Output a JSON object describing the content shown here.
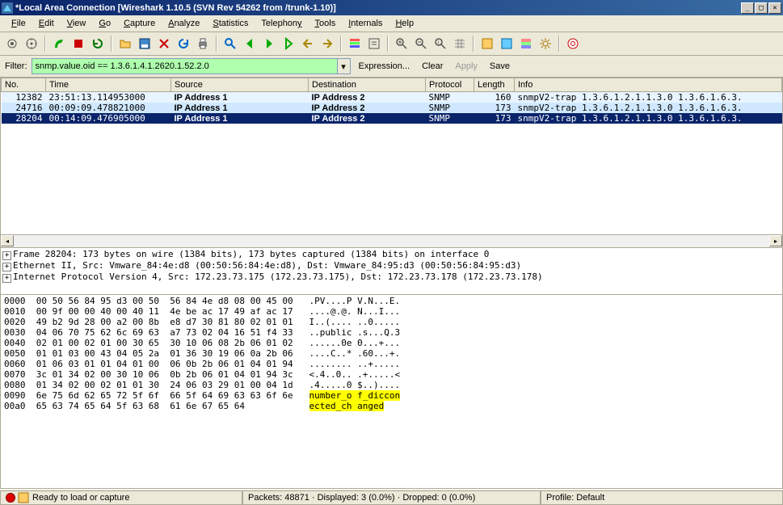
{
  "title": "*Local Area Connection   [Wireshark 1.10.5  (SVN Rev 54262 from /trunk-1.10)]",
  "menu": [
    "File",
    "Edit",
    "View",
    "Go",
    "Capture",
    "Analyze",
    "Statistics",
    "Telephony",
    "Tools",
    "Internals",
    "Help"
  ],
  "filter": {
    "label": "Filter:",
    "value": "snmp.value.oid == 1.3.6.1.4.1.2620.1.52.2.0",
    "expression": "Expression...",
    "clear": "Clear",
    "apply": "Apply",
    "save": "Save"
  },
  "columns": [
    "No.",
    "Time",
    "Source",
    "Destination",
    "Protocol",
    "Length",
    "Info"
  ],
  "rows": [
    {
      "no": "12382",
      "time": "23:51:13.114953000",
      "src": "IP Address 1",
      "dst": "IP Address 2",
      "proto": "SNMP",
      "len": "160",
      "info": "snmpV2-trap 1.3.6.1.2.1.1.3.0 1.3.6.1.6.3."
    },
    {
      "no": "24716",
      "time": "00:09:09.478821000",
      "src": "IP Address 1",
      "dst": "IP Address 2",
      "proto": "SNMP",
      "len": "173",
      "info": "snmpV2-trap 1.3.6.1.2.1.1.3.0 1.3.6.1.6.3."
    },
    {
      "no": "28204",
      "time": "00:14:09.476905000",
      "src": "IP Address 1",
      "dst": "IP Address 2",
      "proto": "SNMP",
      "len": "173",
      "info": "snmpV2-trap 1.3.6.1.2.1.1.3.0 1.3.6.1.6.3."
    }
  ],
  "selected_row": 2,
  "tree": [
    "Frame 28204: 173 bytes on wire (1384 bits), 173 bytes captured (1384 bits) on interface 0",
    "Ethernet II, Src: Vmware_84:4e:d8 (00:50:56:84:4e:d8), Dst: Vmware_84:95:d3 (00:50:56:84:95:d3)",
    "Internet Protocol Version 4, Src: 172.23.73.175 (172.23.73.175), Dst: 172.23.73.178 (172.23.73.178)"
  ],
  "hex": [
    {
      "off": "0000",
      "b": "00 50 56 84 95 d3 00 50  56 84 4e d8 08 00 45 00",
      "a": ".PV....P V.N...E."
    },
    {
      "off": "0010",
      "b": "00 9f 00 00 40 00 40 11  4e be ac 17 49 af ac 17",
      "a": "....@.@. N...I..."
    },
    {
      "off": "0020",
      "b": "49 b2 9d 28 00 a2 00 8b  e8 d7 30 81 80 02 01 01",
      "a": "I..(.... ..0....."
    },
    {
      "off": "0030",
      "b": "04 06 70 75 62 6c 69 63  a7 73 02 04 16 51 f4 33",
      "a": "..public .s...Q.3"
    },
    {
      "off": "0040",
      "b": "02 01 00 02 01 00 30 65  30 10 06 08 2b 06 01 02",
      "a": "......0e 0...+..."
    },
    {
      "off": "0050",
      "b": "01 01 03 00 43 04 05 2a  01 36 30 19 06 0a 2b 06",
      "a": "....C..* .60...+."
    },
    {
      "off": "0060",
      "b": "01 06 03 01 01 04 01 00  06 0b 2b 06 01 04 01 94",
      "a": "........ ..+....."
    },
    {
      "off": "0070",
      "b": "3c 01 34 02 00 30 10 06  0b 2b 06 01 04 01 94 3c",
      "a": "<.4..0.. .+.....<"
    },
    {
      "off": "0080",
      "b": "01 34 02 00 02 01 01 30  24 06 03 29 01 00 04 1d",
      "a": ".4.....0 $..)...."
    },
    {
      "off": "0090",
      "b": "6e 75 6d 62 65 72 5f 6f  66 5f 64 69 63 63 6f 6e",
      "a": "number_o f_diccon",
      "hl": true
    },
    {
      "off": "00a0",
      "b": "65 63 74 65 64 5f 63 68  61 6e 67 65 64         ",
      "a": "ected_ch anged",
      "hl": true
    }
  ],
  "status": {
    "ready": "Ready to load or capture",
    "packets": "Packets: 48871 · Displayed: 3 (0.0%) · Dropped: 0 (0.0%)",
    "profile": "Profile: Default"
  }
}
